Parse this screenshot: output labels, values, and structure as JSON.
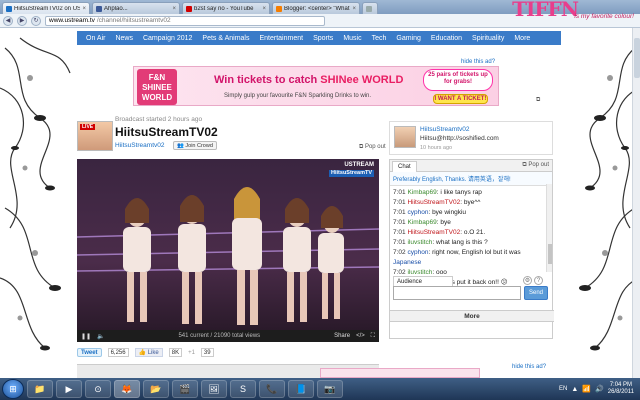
{
  "browser": {
    "tabs": [
      {
        "label": "HiitsuStreamTV02 on USTR",
        "color": "#1a6fc4"
      },
      {
        "label": "Ahplao...",
        "color": "#3b5998"
      },
      {
        "label": "b2st say no - YouTube",
        "color": "#d10000"
      },
      {
        "label": "Blogger: <center> \"What g",
        "color": "#f57d00"
      },
      {
        "label": "",
        "color": "#9aa"
      }
    ],
    "url_domain": "www.ustream.tv",
    "url_path": "/channel/hiitsustreamtv02"
  },
  "decor": {
    "pink_title": "TIFFN",
    "pink_tagline": "is my favorite colour!"
  },
  "nav": [
    "On Air",
    "News",
    "Campaign 2012",
    "Pets & Animals",
    "Entertainment",
    "Sports",
    "Music",
    "Tech",
    "Gaming",
    "Education",
    "Spirituality",
    "More"
  ],
  "ad": {
    "hide_label": "hide this ad?",
    "logo_text": "F&N SHINEE WORLD",
    "headline": "Win tickets to catch",
    "headline_brand": "SHINee WORLD",
    "subline": "Simply gulp your favourite F&N Sparkling Drinks to win.",
    "pairs": "25 pairs of tickets up for grabs!",
    "cta": "I WANT A TICKET!"
  },
  "channel": {
    "broadcast_info": "Broadcast started 2 hours ago",
    "live_badge": "LIVE",
    "title": "HiitsuStreamTV02",
    "user": "HiitsuStreamtv02",
    "join_label": "Join Crowd",
    "popout_label": "Pop out"
  },
  "player": {
    "brand": "USTREAM",
    "tag": "HiitsuStreamTV",
    "views": "541 current / 21090 total views",
    "share_label": "Share"
  },
  "social": {
    "tweet_label": "Tweet",
    "tweet_count": "6,256",
    "like_label": "Like",
    "like_count": "8K",
    "plus_count": "39"
  },
  "owner": {
    "name": "HiitsuStreamtv02",
    "message": "Hiitsu@http://soshified.com",
    "ago": "10 hours ago"
  },
  "chat": {
    "tab_label": "Chat",
    "popout_label": "Pop out",
    "pinned": "Preferably English, Thanks. 请用英语，잘해!",
    "messages": [
      {
        "time": "7:01",
        "user": "Kimbap69",
        "text": "i like tanys rap",
        "style": "u1"
      },
      {
        "time": "7:01",
        "user": "HiitsuStreamTV02",
        "text": "bye^^",
        "style": "u2"
      },
      {
        "time": "7:01",
        "user": "cyphon",
        "text": "bye wingkiu",
        "style": "u3"
      },
      {
        "time": "7:01",
        "user": "Kimbap69",
        "text": "bye",
        "style": "u1"
      },
      {
        "time": "7:01",
        "user": "HiitsuStreamTV02",
        "text": "o.O 21.",
        "style": "u2"
      },
      {
        "time": "7:01",
        "user": "iluvstitch",
        "text": "what lang is this ?",
        "style": "u1"
      },
      {
        "time": "7:02",
        "user": "cyphon",
        "text": "right now, English lol but it was",
        "style": "u3"
      },
      {
        "time": "",
        "user": "",
        "text": "Japanese",
        "style": "u3"
      },
      {
        "time": "7:02",
        "user": "iluvstitch",
        "text": "ooo",
        "style": "u1"
      },
      {
        "time": "7:02",
        "user": "Kimbap69",
        "text": "mars put it back on!! 😕",
        "style": "u1"
      }
    ],
    "audience_label": "Audience",
    "send_label": "Send",
    "more_label": "More"
  },
  "ad2": {
    "hide_label": "hide this ad?"
  },
  "taskbar": {
    "apps": [
      "📁",
      "▶",
      "⊙",
      "🦊",
      "📂",
      "🎬",
      "🖼",
      "S",
      "📞",
      "📘",
      "📷"
    ],
    "lang": "EN",
    "time": "7:04 PM",
    "date": "26/8/2011"
  }
}
